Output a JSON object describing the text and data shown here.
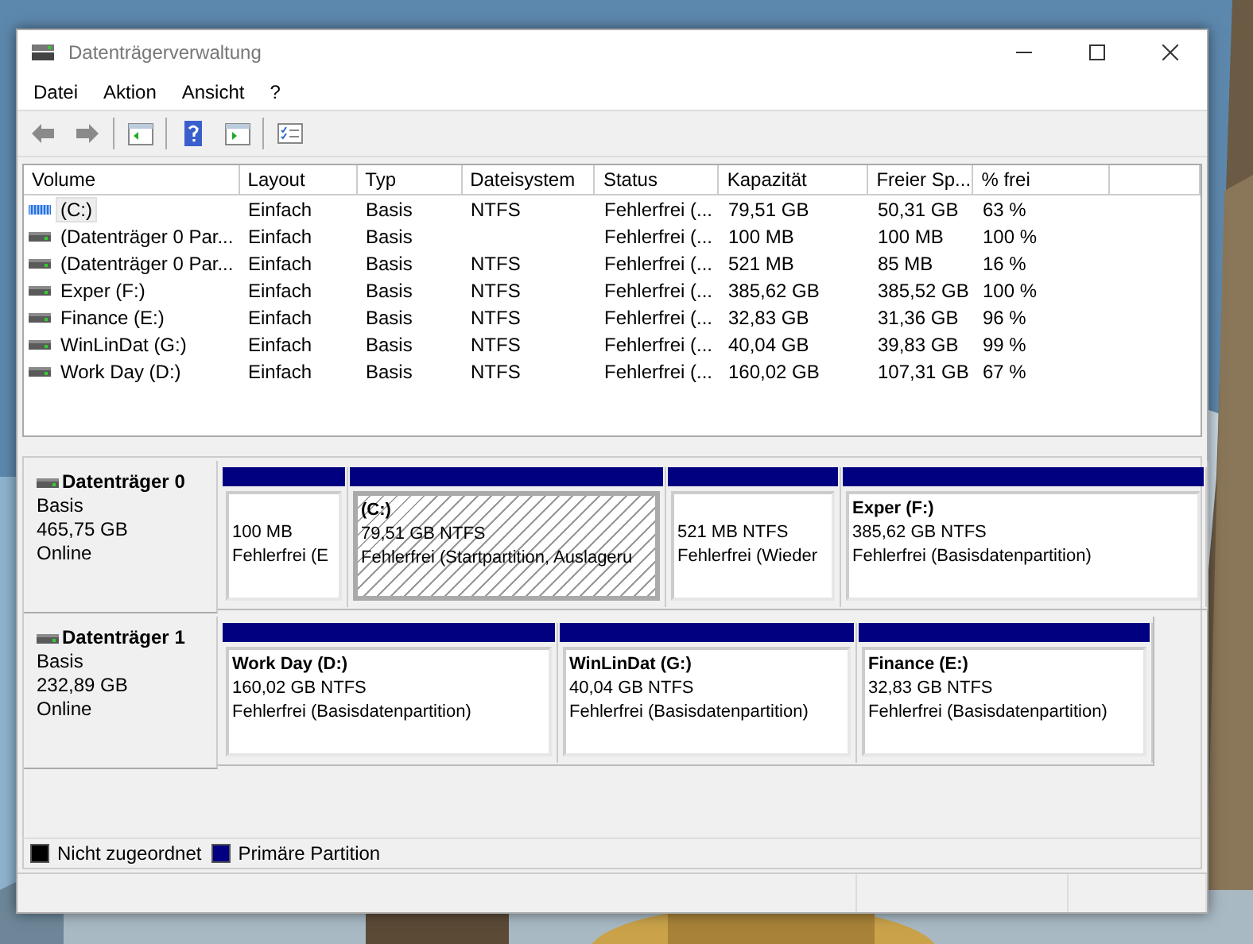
{
  "window": {
    "title": "Datenträgerverwaltung"
  },
  "menu": [
    "Datei",
    "Aktion",
    "Ansicht",
    "?"
  ],
  "volumes": {
    "columns": [
      "Volume",
      "Layout",
      "Typ",
      "Dateisystem",
      "Status",
      "Kapazität",
      "Freier Sp...",
      "% frei"
    ],
    "rows": [
      {
        "selected": true,
        "cells": [
          "(C:)",
          "Einfach",
          "Basis",
          "NTFS",
          "Fehlerfrei (...",
          "79,51 GB",
          "50,31 GB",
          "63 %"
        ]
      },
      {
        "selected": false,
        "cells": [
          "(Datenträger 0 Par...",
          "Einfach",
          "Basis",
          "",
          "Fehlerfrei (...",
          "100 MB",
          "100 MB",
          "100 %"
        ]
      },
      {
        "selected": false,
        "cells": [
          "(Datenträger 0 Par...",
          "Einfach",
          "Basis",
          "NTFS",
          "Fehlerfrei (...",
          "521 MB",
          "85 MB",
          "16 %"
        ]
      },
      {
        "selected": false,
        "cells": [
          "Exper (F:)",
          "Einfach",
          "Basis",
          "NTFS",
          "Fehlerfrei (...",
          "385,62 GB",
          "385,52 GB",
          "100 %"
        ]
      },
      {
        "selected": false,
        "cells": [
          "Finance (E:)",
          "Einfach",
          "Basis",
          "NTFS",
          "Fehlerfrei (...",
          "32,83 GB",
          "31,36 GB",
          "96 %"
        ]
      },
      {
        "selected": false,
        "cells": [
          "WinLinDat (G:)",
          "Einfach",
          "Basis",
          "NTFS",
          "Fehlerfrei (...",
          "40,04 GB",
          "39,83 GB",
          "99 %"
        ]
      },
      {
        "selected": false,
        "cells": [
          "Work Day (D:)",
          "Einfach",
          "Basis",
          "NTFS",
          "Fehlerfrei (...",
          "160,02 GB",
          "107,31 GB",
          "67 %"
        ]
      }
    ]
  },
  "disks": [
    {
      "name": "Datenträger 0",
      "type": "Basis",
      "size": "465,75 GB",
      "status": "Online",
      "partitions": [
        {
          "selected": false,
          "size": "100 MB",
          "state": "Fehlerfrei (E"
        },
        {
          "selected": true,
          "title": "(C:)",
          "size": "79,51 GB NTFS",
          "state": "Fehlerfrei (Startpartition, Auslageru"
        },
        {
          "selected": false,
          "size": "521 MB NTFS",
          "state": "Fehlerfrei (Wieder"
        },
        {
          "selected": false,
          "title": "Exper  (F:)",
          "size": "385,62 GB NTFS",
          "state": "Fehlerfrei (Basisdatenpartition)"
        }
      ]
    },
    {
      "name": "Datenträger 1",
      "type": "Basis",
      "size": "232,89 GB",
      "status": "Online",
      "partitions": [
        {
          "selected": false,
          "title": "Work Day  (D:)",
          "size": "160,02 GB NTFS",
          "state": "Fehlerfrei (Basisdatenpartition)"
        },
        {
          "selected": false,
          "title": "WinLinDat  (G:)",
          "size": "40,04 GB NTFS",
          "state": "Fehlerfrei (Basisdatenpartition)"
        },
        {
          "selected": false,
          "title": "Finance  (E:)",
          "size": "32,83 GB NTFS",
          "state": "Fehlerfrei (Basisdatenpartition)"
        }
      ]
    }
  ],
  "legend": [
    {
      "label": "Nicht zugeordnet",
      "color": "#000000"
    },
    {
      "label": "Primäre Partition",
      "color": "#000080"
    }
  ]
}
